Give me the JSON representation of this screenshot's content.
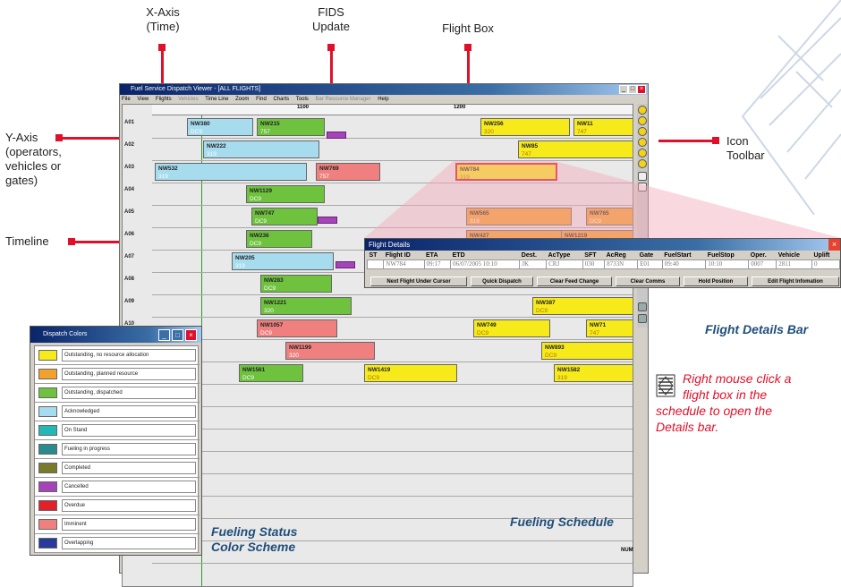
{
  "callouts": {
    "x_axis": [
      "X-Axis",
      "(Time)"
    ],
    "fids": [
      "FIDS",
      "Update"
    ],
    "flight_box": "Flight Box",
    "y_axis": [
      "Y-Axis",
      "(operators,",
      "vehicles or",
      "gates)"
    ],
    "timeline": "Timeline",
    "icon_toolbar": [
      "Icon",
      "Toolbar"
    ]
  },
  "accent_color": "#e0102a",
  "main_window": {
    "title": "Fuel Service Dispatch Viewer - [ALL FLIGHTS]",
    "menu": [
      "File",
      "View",
      "Flights",
      "Vehicles",
      "Time Line",
      "Zoom",
      "Find",
      "Charts",
      "Tools",
      "Bar Resource Manager",
      "Help"
    ],
    "times": [
      "1100",
      "1200"
    ],
    "rows": [
      "A01",
      "A02",
      "A03",
      "A04",
      "A05",
      "A06",
      "A07",
      "A08",
      "A09",
      "A10"
    ],
    "status_tag": "NUM"
  },
  "flights": [
    {
      "id": "NW380",
      "type": "DC9",
      "color": "c-blue"
    },
    {
      "id": "NW215",
      "type": "757",
      "color": "c-green"
    },
    {
      "id": "NW256",
      "type": "320",
      "color": "c-yellow"
    },
    {
      "id": "NW11",
      "type": "747",
      "color": "c-yellow"
    },
    {
      "id": "NW222",
      "type": "319",
      "color": "c-blue"
    },
    {
      "id": "NW85",
      "type": "747",
      "color": "c-yellow"
    },
    {
      "id": "NW532",
      "type": "319",
      "color": "c-blue"
    },
    {
      "id": "NW769",
      "type": "757",
      "color": "c-pink"
    },
    {
      "id": "NW784",
      "type": "319",
      "color": "c-yellow"
    },
    {
      "id": "NW1129",
      "type": "DC9",
      "color": "c-green"
    },
    {
      "id": "NW747",
      "type": "DC9",
      "color": "c-green"
    },
    {
      "id": "NW565",
      "type": "319",
      "color": "c-orange"
    },
    {
      "id": "NW765",
      "type": "DC9",
      "color": "c-orange"
    },
    {
      "id": "NW236",
      "type": "DC9",
      "color": "c-green"
    },
    {
      "id": "NW427",
      "type": "",
      "color": "c-orange"
    },
    {
      "id": "NW1219",
      "type": "",
      "color": "c-orange"
    },
    {
      "id": "NW205",
      "type": "319",
      "color": "c-blue"
    },
    {
      "id": "NW283",
      "type": "DC9",
      "color": "c-green"
    },
    {
      "id": "NW1221",
      "type": "320",
      "color": "c-green"
    },
    {
      "id": "NW387",
      "type": "DC9",
      "color": "c-yellow"
    },
    {
      "id": "NW1057",
      "type": "DC9",
      "color": "c-pink"
    },
    {
      "id": "NW749",
      "type": "DC9",
      "color": "c-yellow"
    },
    {
      "id": "NW71",
      "type": "747",
      "color": "c-yellow"
    },
    {
      "id": "NW1199",
      "type": "320",
      "color": "c-pink"
    },
    {
      "id": "NW893",
      "type": "DC9",
      "color": "c-yellow"
    },
    {
      "id": "NW1561",
      "type": "DC9",
      "color": "c-green"
    },
    {
      "id": "NW1419",
      "type": "DC9",
      "color": "c-yellow"
    },
    {
      "id": "NW1582",
      "type": "319",
      "color": "c-yellow"
    }
  ],
  "flight_details": {
    "title": "Flight Details",
    "columns": [
      "ST",
      "Flight ID",
      "ETA",
      "ETD",
      "Dest.",
      "AcType",
      "SFT",
      "AcReg",
      "Gate",
      "FuelStart",
      "FuelStop",
      "Oper.",
      "Vehicle",
      "Uplift"
    ],
    "values": [
      "",
      "NW784",
      "09:17",
      "06/07/2005 10:10",
      "JK",
      "CRJ",
      "030",
      "8733N",
      "E01",
      "09:40",
      "10:10",
      "0007",
      "2811",
      "0"
    ],
    "buttons": [
      "Next Flight Under Cursor",
      "Quick Dispatch",
      "Clear Feed Change",
      "Clear Comms",
      "Hold Position",
      "Edit Flight Infomation"
    ]
  },
  "dispatch_colors": {
    "title": "Dispatch Colors",
    "items": [
      {
        "label": "Outstanding, no resource allocation",
        "color": "#f6ea1a"
      },
      {
        "label": "Outstanding, planned resource",
        "color": "#f2a12d"
      },
      {
        "label": "Outstanding, dispatched",
        "color": "#6ec23e"
      },
      {
        "label": "Acknowledged",
        "color": "#a6dcee"
      },
      {
        "label": "On Stand",
        "color": "#22b8b8"
      },
      {
        "label": "Fueling in progress",
        "color": "#2a8a8e"
      },
      {
        "label": "Completed",
        "color": "#7a7a2a"
      },
      {
        "label": "Cancelled",
        "color": "#a444b8"
      },
      {
        "label": "Overdue",
        "color": "#e0202a"
      },
      {
        "label": "Imminent",
        "color": "#f08080"
      },
      {
        "label": "Overlapping",
        "color": "#2a3a9a"
      }
    ]
  },
  "captions": {
    "flight_details_bar": "Flight Details Bar",
    "fueling_status": [
      "Fueling Status",
      "Color Scheme"
    ],
    "fueling_schedule": "Fueling Schedule"
  },
  "hint": [
    "Right mouse click a",
    "flight box in the",
    "schedule to open the",
    "Details bar."
  ]
}
